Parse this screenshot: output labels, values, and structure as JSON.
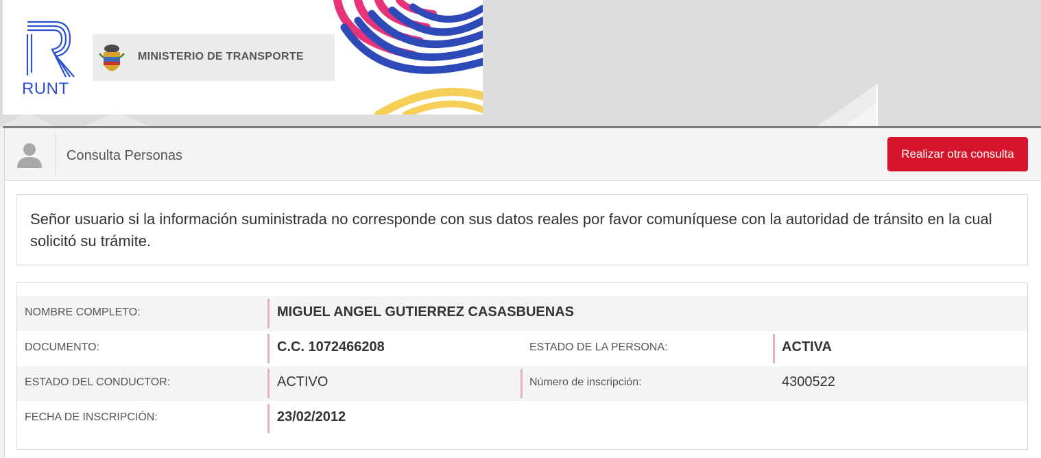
{
  "brand": {
    "runt_text": "RUNT",
    "ministry": "MINISTERIO DE TRANSPORTE"
  },
  "panel": {
    "title": "Consulta Personas",
    "action_button": "Realizar otra consulta"
  },
  "notice": "Señor usuario si la información suministrada no corresponde con sus datos reales por favor comuníquese con la autoridad de tránsito en la cual solicitó su trámite.",
  "person": {
    "nombre_label": "NOMBRE COMPLETO:",
    "nombre_value": "MIGUEL ANGEL GUTIERREZ CASASBUENAS",
    "documento_label": "DOCUMENTO:",
    "documento_value": "C.C. 1072466208",
    "estado_persona_label": "ESTADO DE LA PERSONA:",
    "estado_persona_value": "ACTIVA",
    "estado_conductor_label": "ESTADO DEL CONDUCTOR:",
    "estado_conductor_value": "ACTIVO",
    "inscripcion_num_label": "Número de inscripción:",
    "inscripcion_num_value": "4300522",
    "fecha_label": "FECHA DE INSCRIPCIÓN:",
    "fecha_value": "23/02/2012"
  },
  "colors": {
    "brand_blue": "#2b4fd1",
    "button_red": "#d6152d",
    "accent_bar": "#e2b2bb"
  }
}
